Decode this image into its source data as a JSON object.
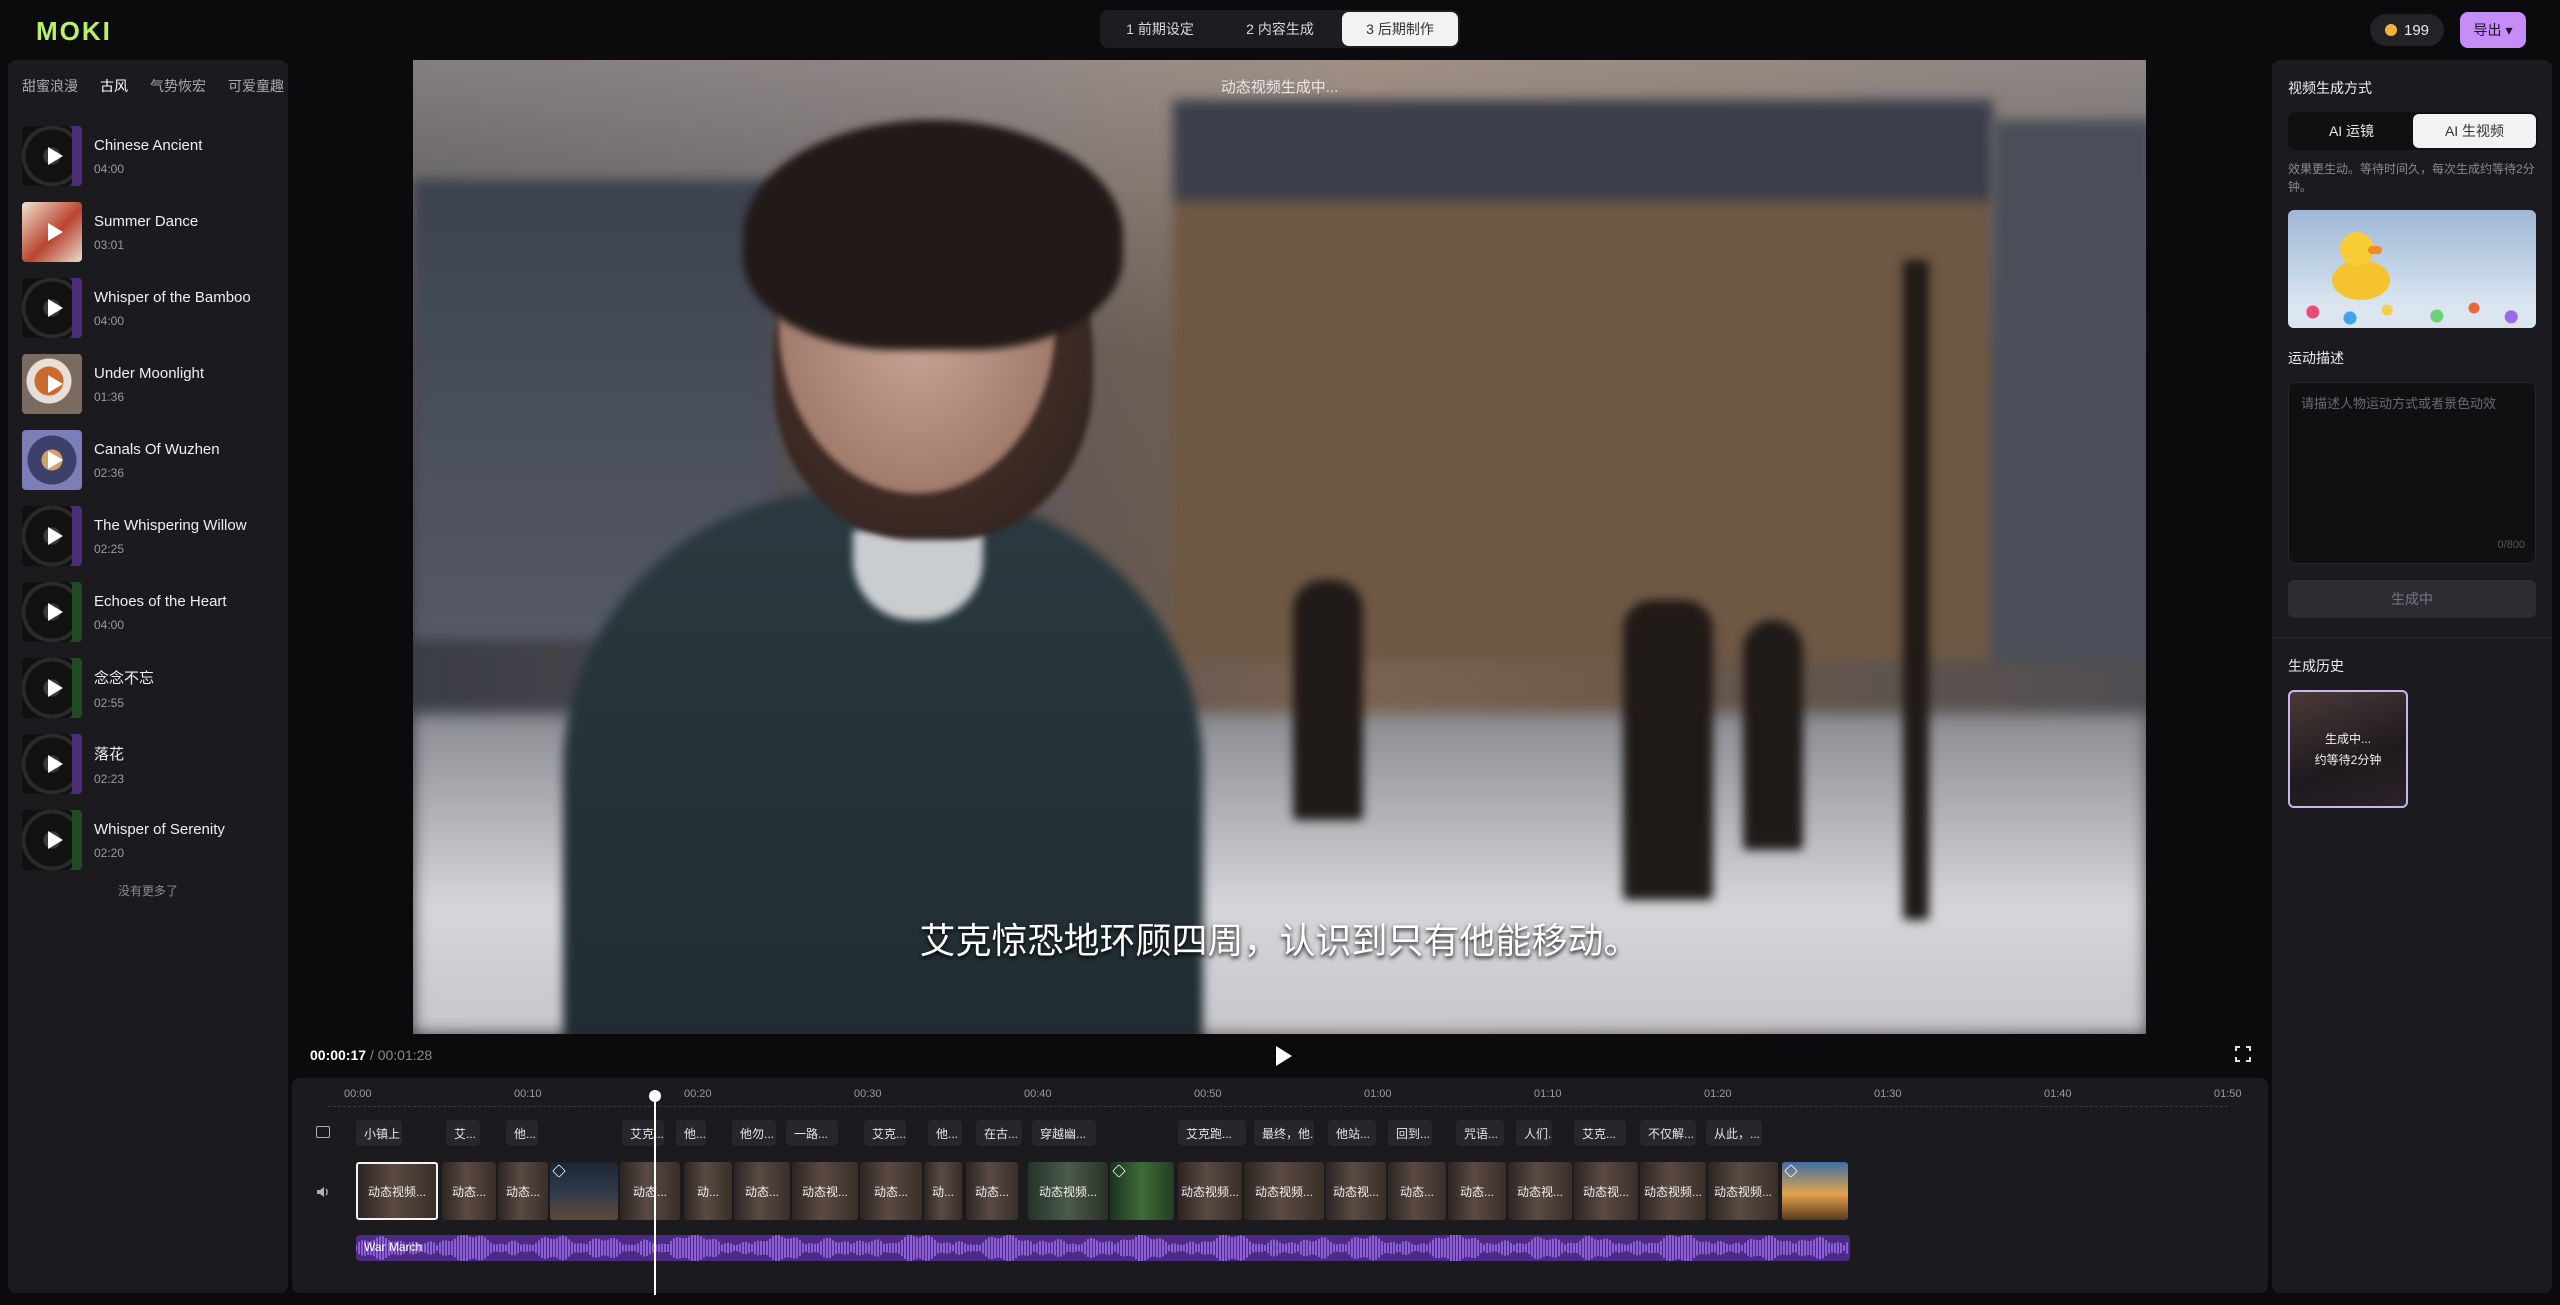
{
  "app": {
    "logo": "MOKI"
  },
  "steps": [
    {
      "label": "1 前期设定"
    },
    {
      "label": "2 内容生成"
    },
    {
      "label": "3 后期制作"
    }
  ],
  "coins": "199",
  "export_label": "导出",
  "genres": [
    "甜蜜浪漫",
    "古风",
    "气势恢宏",
    "可爱童趣"
  ],
  "active_genre": "古风",
  "tracks": [
    {
      "name": "Chinese Ancient",
      "duration": "04:00"
    },
    {
      "name": "Summer Dance",
      "duration": "03:01"
    },
    {
      "name": "Whisper of the Bamboo",
      "duration": "04:00"
    },
    {
      "name": "Under Moonlight",
      "duration": "01:36"
    },
    {
      "name": "Canals Of Wuzhen",
      "duration": "02:36"
    },
    {
      "name": "The Whispering Willow",
      "duration": "02:25"
    },
    {
      "name": "Echoes of the Heart",
      "duration": "04:00"
    },
    {
      "name": "念念不忘",
      "duration": "02:55"
    },
    {
      "name": "落花",
      "duration": "02:23"
    },
    {
      "name": "Whisper of Serenity",
      "duration": "02:20"
    }
  ],
  "no_more": "没有更多了",
  "preview": {
    "status": "动态视频生成中...",
    "subtitle": "艾克惊恐地环顾四周，认识到只有他能移动。"
  },
  "player": {
    "current": "00:00:17",
    "separator": " / ",
    "total": "00:01:28"
  },
  "timeline": {
    "ticks": [
      "00:00",
      "00:10",
      "00:20",
      "00:30",
      "00:40",
      "00:50",
      "01:00",
      "01:10",
      "01:20",
      "01:30",
      "01:40",
      "01:50"
    ],
    "playhead_seconds": 17.6,
    "subtitle_chips": [
      "小镇上，...",
      "艾...",
      "他...",
      "艾克...",
      "他...",
      "他勿...",
      "一路...",
      "艾克...",
      "他...",
      "在古...",
      "穿越幽...",
      "艾克跑...",
      "最终，他...",
      "他站...",
      "回到...",
      "咒语...",
      "人们...",
      "艾克...",
      "不仅解...",
      "从此，..."
    ],
    "clips": [
      "动态视频...",
      "动态...",
      "动态...",
      "",
      "动态...",
      "动...",
      "动态...",
      "动态视...",
      "动态...",
      "动...",
      "动态...",
      "动态视频...",
      "",
      "动态视频...",
      "动态视频...",
      "动态视...",
      "动态...",
      "动态...",
      "动态视...",
      "动态视...",
      "动态视频...",
      "动态视频...",
      ""
    ],
    "audio_label": "War March"
  },
  "right": {
    "method_title": "视频生成方式",
    "mode_a": "AI 运镜",
    "mode_b": "AI 生视频",
    "desc": "效果更生动。等待时间久，每次生成约等待2分钟。",
    "motion_title": "运动描述",
    "placeholder": "请描述人物运动方式或者景色动效",
    "counter": "0/800",
    "generate_label": "生成中",
    "history_title": "生成历史",
    "history_line1": "生成中...",
    "history_line2": "约等待2分钟"
  }
}
